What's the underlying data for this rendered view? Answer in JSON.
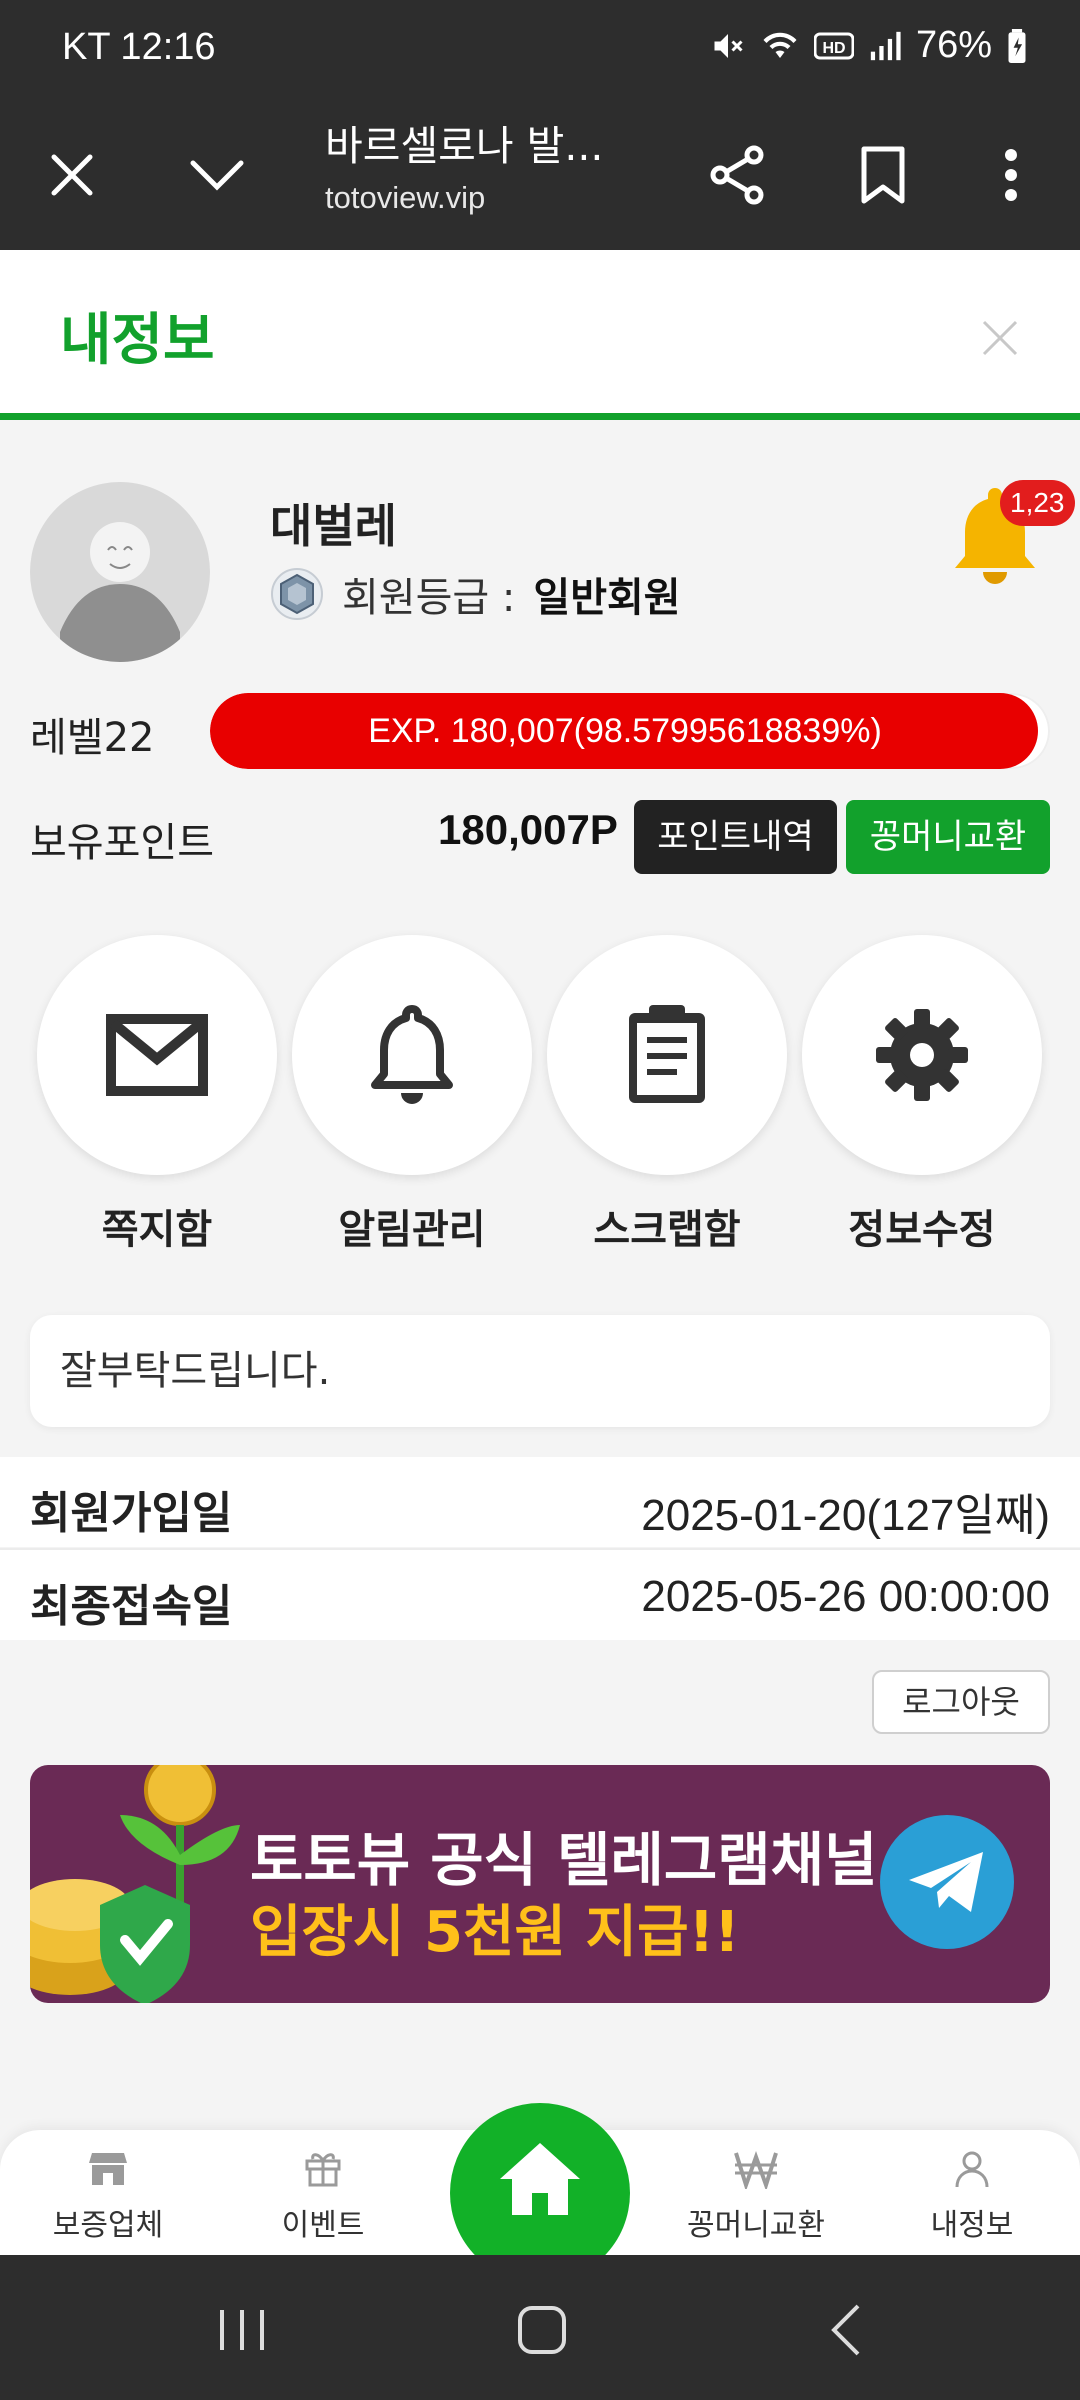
{
  "status_bar": {
    "carrier_time": "KT 12:16",
    "battery": "76%"
  },
  "browser": {
    "title": "바르셀로나 발...",
    "url": "totoview.vip"
  },
  "page": {
    "title": "내정보"
  },
  "profile": {
    "nickname": "대벌레",
    "grade_label": "회원등급 :",
    "grade_value": "일반회원",
    "notification_count": "1,23"
  },
  "level": {
    "label": "레벨22",
    "exp_text": "EXP. 180,007(98.57995618839%)",
    "exp_percent": 98.57995618839
  },
  "points": {
    "label": "보유포인트",
    "value": "180,007P",
    "history_button": "포인트내역",
    "exchange_button": "꽁머니교환"
  },
  "actions": [
    {
      "label": "쪽지함",
      "icon": "mail-icon"
    },
    {
      "label": "알림관리",
      "icon": "bell-icon"
    },
    {
      "label": "스크랩함",
      "icon": "clipboard-icon"
    },
    {
      "label": "정보수정",
      "icon": "gear-icon"
    }
  ],
  "greeting": "잘부탁드립니다.",
  "info": {
    "join_label": "회원가입일",
    "join_value": "2025-01-20(127일째)",
    "last_label": "최종접속일",
    "last_value": "2025-05-26 00:00:00"
  },
  "logout_label": "로그아웃",
  "banner": {
    "line1": "토토뷰 공식 텔레그램채널",
    "line2": "입장시 5천원 지급!!"
  },
  "bottom_nav": [
    {
      "label": "보증업체",
      "icon": "store-icon"
    },
    {
      "label": "이벤트",
      "icon": "gift-icon"
    },
    {
      "label": "",
      "icon": "home-icon"
    },
    {
      "label": "꽁머니교환",
      "icon": "won-icon"
    },
    {
      "label": "내정보",
      "icon": "person-icon"
    }
  ],
  "colors": {
    "brand_green": "#12a12c",
    "exp_red": "#e80000",
    "banner_purple": "#6a2a55",
    "telegram_blue": "#2a9fd6"
  }
}
